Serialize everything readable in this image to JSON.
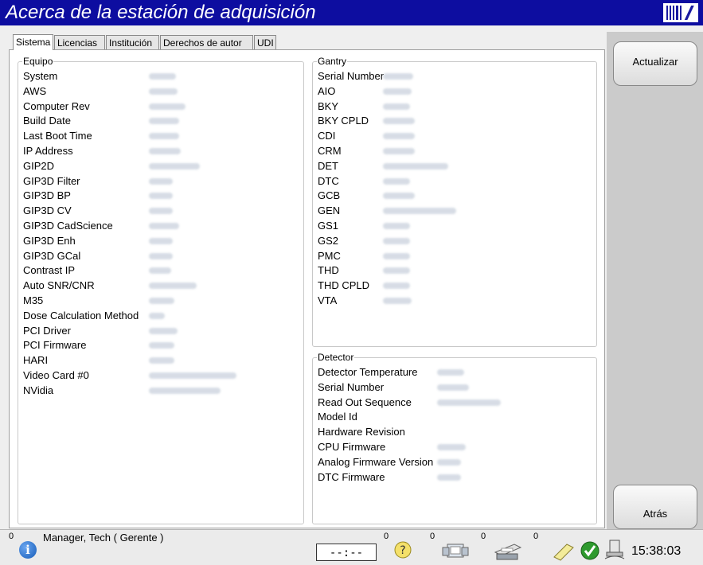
{
  "window": {
    "title": "Acerca de la estación de adquisición"
  },
  "tabs": [
    {
      "label": "Sistema",
      "active": true
    },
    {
      "label": "Licencias",
      "active": false
    },
    {
      "label": "Institución",
      "active": false
    },
    {
      "label": "Derechos de autor",
      "active": false
    },
    {
      "label": "UDI",
      "active": false
    }
  ],
  "equipo": {
    "title": "Equipo",
    "rows": [
      {
        "label": "System"
      },
      {
        "label": "AWS"
      },
      {
        "label": "Computer Rev"
      },
      {
        "label": "Build Date"
      },
      {
        "label": "Last Boot Time"
      },
      {
        "label": "IP Address"
      },
      {
        "label": "GIP2D"
      },
      {
        "label": "GIP3D Filter"
      },
      {
        "label": "GIP3D BP"
      },
      {
        "label": "GIP3D CV"
      },
      {
        "label": "GIP3D CadScience"
      },
      {
        "label": "GIP3D Enh"
      },
      {
        "label": "GIP3D GCal"
      },
      {
        "label": "Contrast IP"
      },
      {
        "label": "Auto SNR/CNR"
      },
      {
        "label": "M35"
      },
      {
        "label": "Dose Calculation Method"
      },
      {
        "label": "PCI Driver"
      },
      {
        "label": "PCI Firmware"
      },
      {
        "label": "HARI"
      },
      {
        "label": "Video Card #0"
      },
      {
        "label": "NVidia"
      }
    ]
  },
  "gantry": {
    "title": "Gantry",
    "rows": [
      {
        "label": "Serial Number"
      },
      {
        "label": "AIO"
      },
      {
        "label": "BKY"
      },
      {
        "label": "BKY CPLD"
      },
      {
        "label": "CDI"
      },
      {
        "label": "CRM"
      },
      {
        "label": "DET"
      },
      {
        "label": "DTC"
      },
      {
        "label": "GCB"
      },
      {
        "label": "GEN"
      },
      {
        "label": "GS1"
      },
      {
        "label": "GS2"
      },
      {
        "label": "PMC"
      },
      {
        "label": "THD"
      },
      {
        "label": "THD CPLD"
      },
      {
        "label": "VTA"
      }
    ]
  },
  "detector": {
    "title": "Detector",
    "rows": [
      {
        "label": "Detector Temperature"
      },
      {
        "label": "Serial Number"
      },
      {
        "label": "Read Out Sequence"
      },
      {
        "label": "Model Id"
      },
      {
        "label": "Hardware Revision"
      },
      {
        "label": "CPU Firmware"
      },
      {
        "label": "Analog Firmware Version"
      },
      {
        "label": "DTC Firmware"
      }
    ]
  },
  "sidebar": {
    "refresh_label": "Actualizar",
    "back_label": "Atrás"
  },
  "statusbar": {
    "user": "Manager, Tech ( Gerente )",
    "info_count": "0",
    "clock_display": "--:--",
    "help_count": "0",
    "queue_count": "0",
    "print_count": "0",
    "notes_count": "0",
    "time": "15:38:03"
  },
  "colors": {
    "titlebar": "#0d0da0",
    "sidebar": "#cbcbcb",
    "status_ok": "#2e9a2e"
  }
}
